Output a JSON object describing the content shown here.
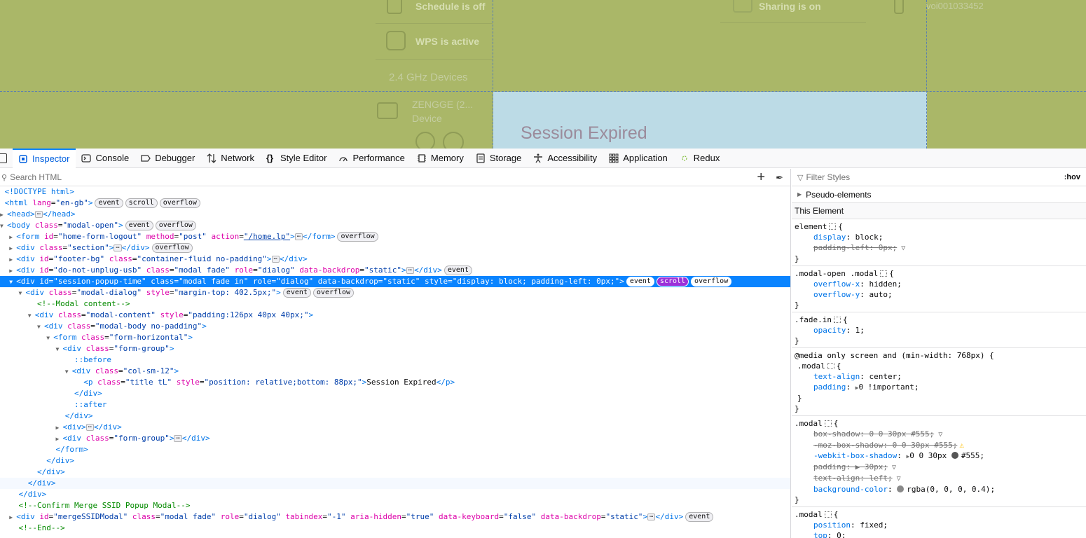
{
  "viewport": {
    "items": [
      {
        "label": "Schedule is off"
      },
      {
        "label": "WPS is active"
      },
      {
        "label": "Sharing is on"
      },
      {
        "label": "voi001033452"
      }
    ],
    "section_header": "2.4 GHz Devices",
    "device_name": "ZENGGE (2...",
    "device_type": "Device",
    "modal_title": "Session Expired",
    "backdrop_color": "#aab768",
    "highlight_color": "#bcdbe6"
  },
  "toolbar": {
    "tabs": [
      {
        "label": "Inspector",
        "icon": "inspector-icon",
        "active": true
      },
      {
        "label": "Console",
        "icon": "console-icon"
      },
      {
        "label": "Debugger",
        "icon": "debugger-icon"
      },
      {
        "label": "Network",
        "icon": "network-icon"
      },
      {
        "label": "Style Editor",
        "icon": "style-editor-icon"
      },
      {
        "label": "Performance",
        "icon": "performance-icon"
      },
      {
        "label": "Memory",
        "icon": "memory-icon"
      },
      {
        "label": "Storage",
        "icon": "storage-icon"
      },
      {
        "label": "Accessibility",
        "icon": "accessibility-icon"
      },
      {
        "label": "Application",
        "icon": "application-icon"
      },
      {
        "label": "Redux",
        "icon": "redux-icon"
      }
    ]
  },
  "markup": {
    "search_placeholder": "Search HTML",
    "lines": {
      "doctype": "<!DOCTYPE html>",
      "comment_modal_content": "<!--Modal content-->",
      "comment_confirm": "<!--Confirm Merge SSID Popup Modal-->",
      "comment_end": "<!--End-->",
      "before": "::before",
      "after": "::after",
      "p_text": "Session Expired"
    },
    "badges": {
      "event": "event",
      "scroll": "scroll",
      "overflow": "overflow"
    }
  },
  "rules": {
    "filter_placeholder": "Filter Styles",
    "hov_label": ":hov",
    "pseudo_elements": "Pseudo-elements",
    "this_element": "This Element",
    "accent_color": "#0a84ff"
  }
}
